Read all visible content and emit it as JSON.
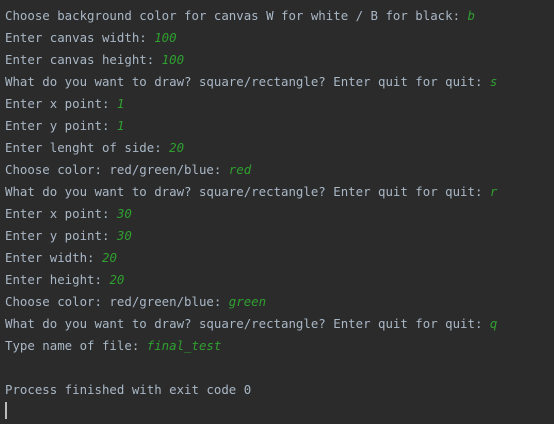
{
  "colors": {
    "background": "#2b2b2b",
    "prompt_text": "#a9b7c6",
    "user_input": "#30a030"
  },
  "console": {
    "lines": [
      {
        "prompt": "Choose background color for canvas W for white / B for black: ",
        "input": "b"
      },
      {
        "prompt": "Enter canvas width: ",
        "input": "100"
      },
      {
        "prompt": "Enter canvas height: ",
        "input": "100"
      },
      {
        "prompt": "What do you want to draw? square/rectangle? Enter quit for quit: ",
        "input": "s"
      },
      {
        "prompt": "Enter x point: ",
        "input": "1"
      },
      {
        "prompt": "Enter y point: ",
        "input": "1"
      },
      {
        "prompt": "Enter lenght of side: ",
        "input": "20"
      },
      {
        "prompt": "Choose color: red/green/blue: ",
        "input": "red"
      },
      {
        "prompt": "What do you want to draw? square/rectangle? Enter quit for quit: ",
        "input": "r"
      },
      {
        "prompt": "Enter x point: ",
        "input": "30"
      },
      {
        "prompt": "Enter y point: ",
        "input": "30"
      },
      {
        "prompt": "Enter width: ",
        "input": "20"
      },
      {
        "prompt": "Enter height: ",
        "input": "20"
      },
      {
        "prompt": "Choose color: red/green/blue: ",
        "input": "green"
      },
      {
        "prompt": "What do you want to draw? square/rectangle? Enter quit for quit: ",
        "input": "q"
      },
      {
        "prompt": "Type name of file: ",
        "input": "final_test"
      },
      {
        "prompt": "",
        "input": ""
      },
      {
        "prompt": "Process finished with exit code 0",
        "input": ""
      }
    ]
  }
}
